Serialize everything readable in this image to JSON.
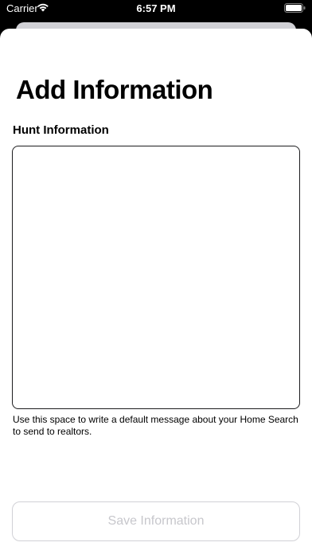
{
  "status_bar": {
    "carrier": "Carrier",
    "time": "6:57 PM",
    "wifi_icon": "wifi-icon",
    "battery_icon": "battery-icon"
  },
  "sheet": {
    "title": "Add Information",
    "section_label": "Hunt Information",
    "textarea": {
      "value": "",
      "placeholder": ""
    },
    "helper_text": "Use this space to write a default message about your Home Search to send to realtors.",
    "save_label": "Save Information"
  },
  "colors": {
    "text": "#000000",
    "border": "#1c1c1e",
    "disabled_text": "#c7c7cc",
    "disabled_border": "#d1d1d6"
  }
}
